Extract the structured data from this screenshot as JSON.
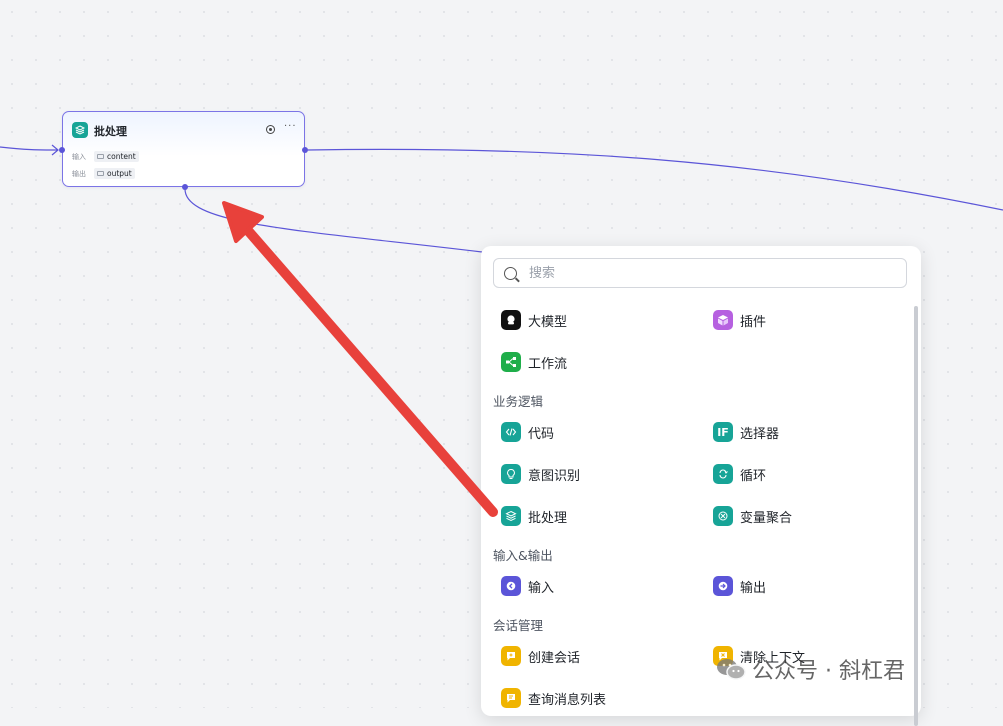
{
  "node": {
    "title": "批处理",
    "input_label": "输入",
    "input_value": "content",
    "output_label": "输出",
    "output_value": "output",
    "icon": "layers-icon",
    "color": "#17a497"
  },
  "panel": {
    "search_placeholder": "搜索",
    "top_items": [
      {
        "label": "大模型",
        "icon": "llm-icon",
        "color": "#111111"
      },
      {
        "label": "插件",
        "icon": "plugin-cube-icon",
        "color": "#b660e0"
      },
      {
        "label": "工作流",
        "icon": "workflow-icon",
        "color": "#1fae4a"
      }
    ],
    "sections": [
      {
        "title": "业务逻辑",
        "items": [
          {
            "label": "代码",
            "icon": "code-icon",
            "color": "#17a497"
          },
          {
            "label": "选择器",
            "icon": "if-icon",
            "color": "#17a497"
          },
          {
            "label": "意图识别",
            "icon": "bulb-icon",
            "color": "#17a497"
          },
          {
            "label": "循环",
            "icon": "loop-icon",
            "color": "#17a497"
          },
          {
            "label": "批处理",
            "icon": "layers-icon",
            "color": "#17a497"
          },
          {
            "label": "变量聚合",
            "icon": "aggregate-icon",
            "color": "#17a497"
          }
        ]
      },
      {
        "title": "输入&输出",
        "items": [
          {
            "label": "输入",
            "icon": "input-icon",
            "color": "#5b55d8"
          },
          {
            "label": "输出",
            "icon": "output-icon",
            "color": "#5b55d8"
          }
        ]
      },
      {
        "title": "会话管理",
        "items": [
          {
            "label": "创建会话",
            "icon": "create-chat-icon",
            "color": "#f0b400"
          },
          {
            "label": "清除上下文",
            "icon": "clear-context-icon",
            "color": "#f0b400"
          },
          {
            "label": "查询消息列表",
            "icon": "message-list-icon",
            "color": "#f0b400"
          }
        ]
      }
    ]
  },
  "watermark": {
    "text": "公众号 · 斜杠君",
    "icon": "wechat-icon"
  },
  "colors": {
    "wire": "#5b55d8",
    "arrow": "#e8413b",
    "canvas": "#f3f4f6"
  }
}
